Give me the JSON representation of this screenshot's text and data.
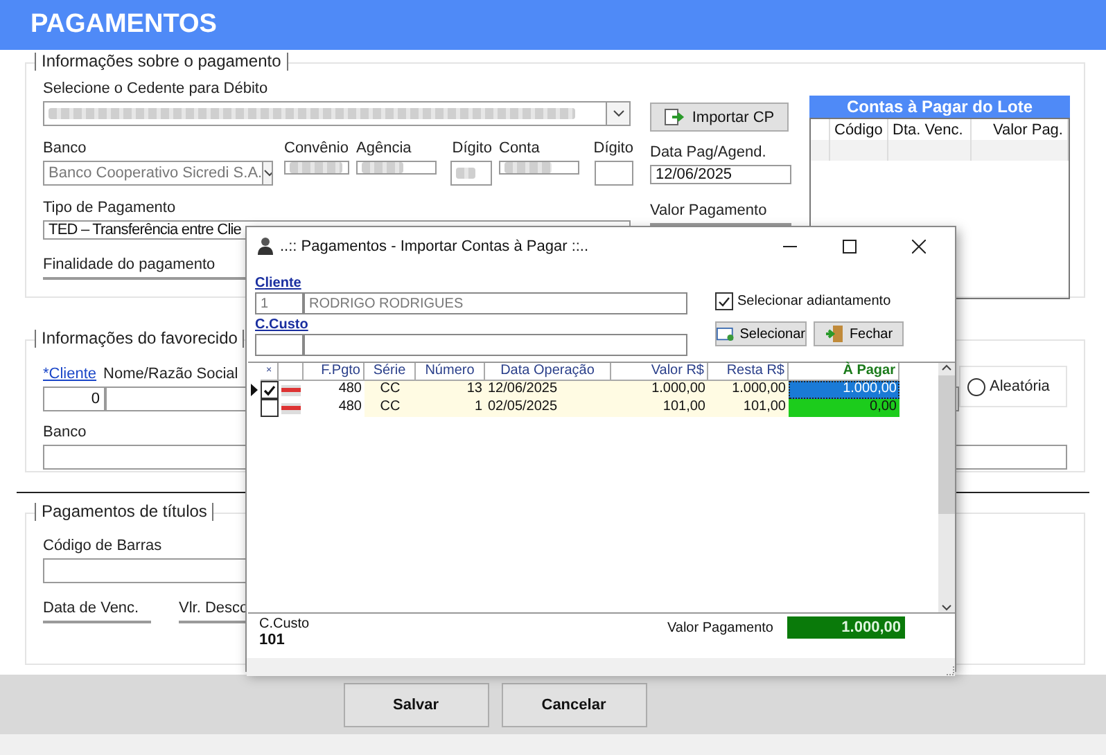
{
  "header": {
    "title": "PAGAMENTOS"
  },
  "payment_info": {
    "legend": "Informações sobre o pagamento",
    "cedente_label": "Selecione o Cedente para Débito",
    "banco_label": "Banco",
    "banco_value": "Banco Cooperativo Sicredi S.A.",
    "convenio_label": "Convênio",
    "agencia_label": "Agência",
    "digito_label": "Dígito",
    "conta_label": "Conta",
    "digito2_label": "Dígito",
    "tipo_label": "Tipo de Pagamento",
    "tipo_value": "TED – Transferência entre Clie",
    "finalidade_label": "Finalidade do pagamento",
    "import_button": "Importar CP",
    "data_label": "Data Pag/Agend.",
    "data_value": "12/06/2025",
    "valor_label": "Valor Pagamento"
  },
  "batch_panel": {
    "title": "Contas à Pagar do Lote",
    "columns": [
      "Código",
      "Dta. Venc.",
      "Valor Pag."
    ]
  },
  "payee": {
    "legend": "Informações do favorecido",
    "cliente_link": "*Cliente",
    "name_label": "Nome/Razão Social",
    "cliente_value": "0",
    "banco_label": "Banco",
    "radio": {
      "label": "Aleatória",
      "selected": false
    }
  },
  "titles": {
    "legend": "Pagamentos de títulos",
    "barcode_label": "Código de Barras",
    "due_label": "Data de Venc.",
    "discount_label": "Vlr. Desco"
  },
  "dialog": {
    "title": "..:: Pagamentos - Importar Contas à Pagar ::..",
    "cliente_link": "Cliente",
    "cliente_code": "1",
    "cliente_name": "RODRIGO RODRIGUES",
    "custo_link": "C.Custo",
    "checkbox": {
      "label": "Selecionar adiantamento",
      "checked": true
    },
    "buttons": [
      "Selecionar",
      "Fechar"
    ],
    "columns": [
      "×",
      "F.Pgto",
      "Série",
      "Número",
      "Data Operação",
      "Valor R$",
      "Resta R$",
      "À Pagar"
    ],
    "rows": [
      {
        "current": true,
        "checked": true,
        "fpgto": "480",
        "serie": "CC",
        "numero": "13",
        "data": "12/06/2025",
        "valor": "1.000,00",
        "resta": "1.000,00",
        "a_pagar": "1.000,00",
        "focused": true
      },
      {
        "current": false,
        "checked": false,
        "fpgto": "480",
        "serie": "CC",
        "numero": "1",
        "data": "02/05/2025",
        "valor": "101,00",
        "resta": "101,00",
        "a_pagar": "0,00",
        "focused": false
      }
    ],
    "custo_label": "C.Custo",
    "custo_value": "101",
    "valor_label": "Valor Pagamento",
    "valor_value": "1.000,00"
  },
  "footer": {
    "buttons": [
      "Salvar",
      "Cancelar"
    ]
  }
}
